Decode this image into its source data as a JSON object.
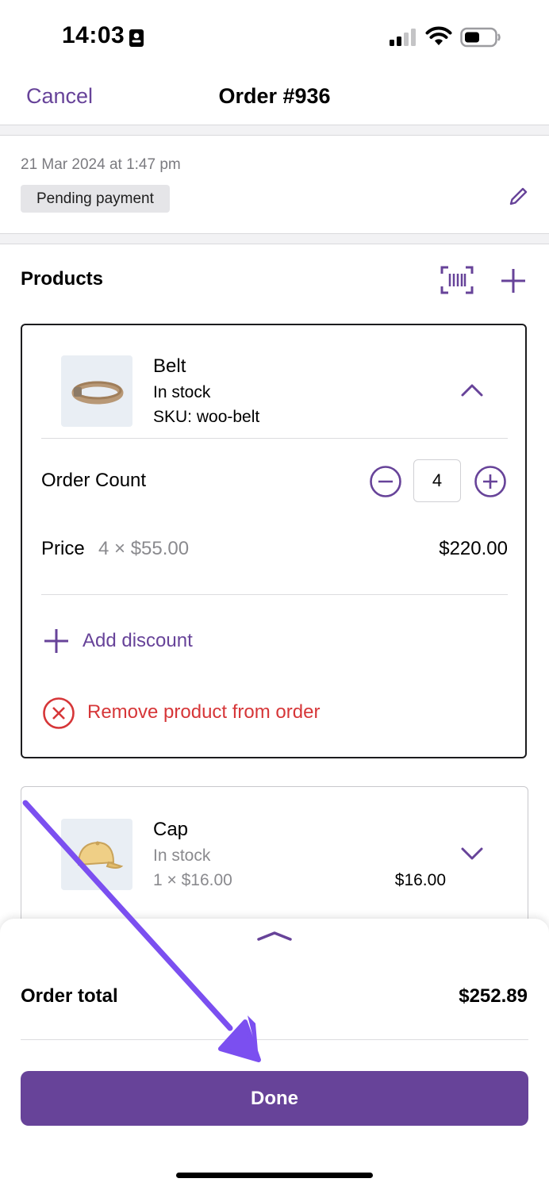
{
  "status_bar": {
    "time": "14:03"
  },
  "nav": {
    "cancel_label": "Cancel",
    "title": "Order #936"
  },
  "order": {
    "date": "21 Mar 2024 at 1:47 pm",
    "status": "Pending payment"
  },
  "products": {
    "heading": "Products",
    "items": [
      {
        "name": "Belt",
        "stock": "In stock",
        "sku": "SKU: woo-belt",
        "order_count_label": "Order Count",
        "quantity": "4",
        "price_label": "Price",
        "price_breakdown": "4 × $55.00",
        "price_total": "$220.00",
        "add_discount_label": "Add discount",
        "remove_label": "Remove product from order"
      },
      {
        "name": "Cap",
        "stock": "In stock",
        "price_breakdown": "1 × $16.00",
        "price_total": "$16.00"
      }
    ]
  },
  "summary": {
    "total_label": "Order total",
    "total_value": "$252.89",
    "done_label": "Done"
  },
  "colors": {
    "accent": "#674399",
    "danger": "#d63638",
    "annotation_arrow": "#7b4ff0"
  }
}
